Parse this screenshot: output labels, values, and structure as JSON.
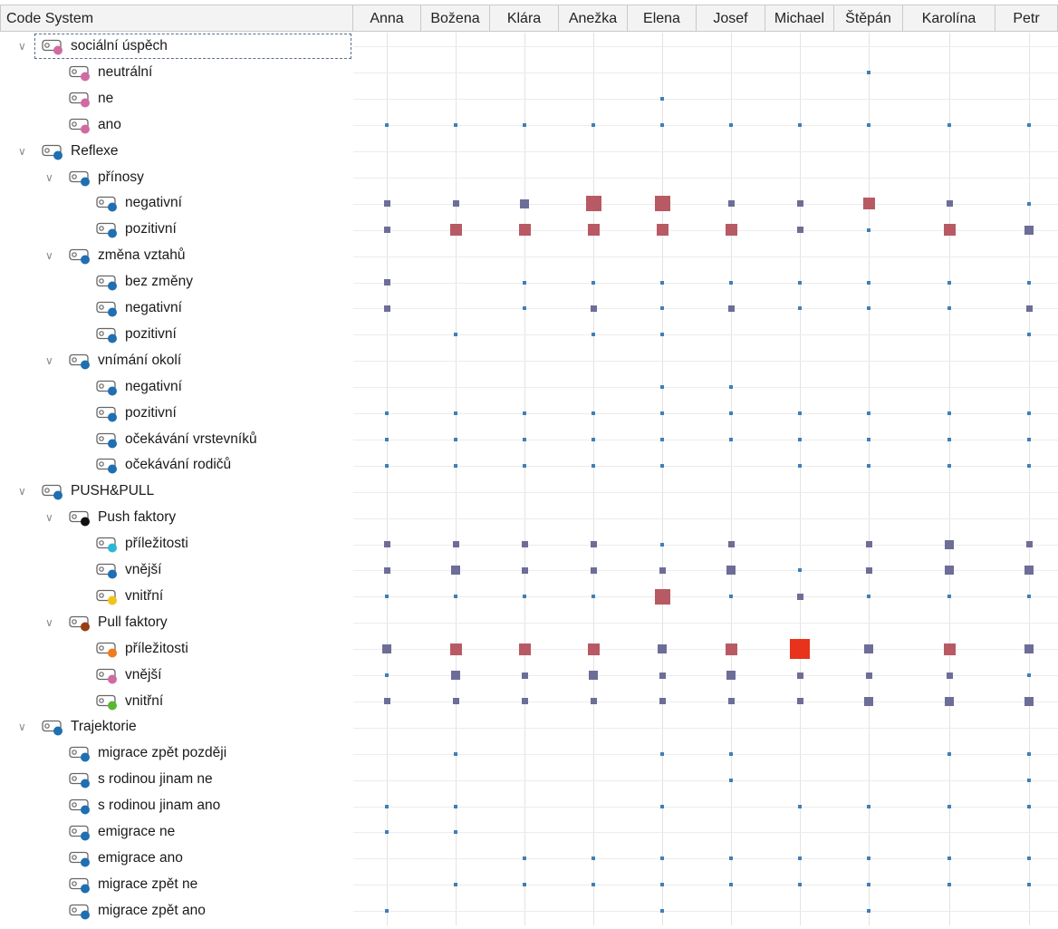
{
  "header": {
    "first_col": "Code System",
    "columns": [
      "Anna",
      "Božena",
      "Klára",
      "Anežka",
      "Elena",
      "Josef",
      "Michael",
      "Štěpán",
      "Karolína",
      "Petr"
    ]
  },
  "colors": {
    "pink": "#d16aa3",
    "blue": "#1f6fb2",
    "black": "#111111",
    "cyan": "#29b8d8",
    "yellow": "#f0c419",
    "brown": "#9a3d12",
    "orange": "#f07a1e",
    "green": "#5ab732",
    "cell_small": "#3f7fb8",
    "cell_mid": "#6d6d98",
    "cell_large": "#b75a64",
    "cell_max": "#e8321c"
  },
  "rows": [
    {
      "label": "sociální úspěch",
      "level": 0,
      "expander": true,
      "dot": "pink",
      "focused": true,
      "cells": [
        0,
        0,
        0,
        0,
        0,
        0,
        0,
        0,
        0,
        0
      ]
    },
    {
      "label": "neutrální",
      "level": 1,
      "expander": false,
      "dot": "pink",
      "cells": [
        0,
        0,
        0,
        0,
        0,
        0,
        0,
        1,
        0,
        0
      ]
    },
    {
      "label": "ne",
      "level": 1,
      "expander": false,
      "dot": "pink",
      "cells": [
        0,
        0,
        0,
        0,
        1,
        0,
        0,
        0,
        0,
        0
      ]
    },
    {
      "label": "ano",
      "level": 1,
      "expander": false,
      "dot": "pink",
      "cells": [
        1,
        1,
        1,
        1,
        1,
        1,
        1,
        1,
        1,
        1
      ]
    },
    {
      "label": "Reflexe",
      "level": 0,
      "expander": true,
      "dot": "blue",
      "cells": [
        0,
        0,
        0,
        0,
        0,
        0,
        0,
        0,
        0,
        0
      ]
    },
    {
      "label": "přínosy",
      "level": 1,
      "expander": true,
      "dot": "blue",
      "cells": [
        0,
        0,
        0,
        0,
        0,
        0,
        0,
        0,
        0,
        0
      ]
    },
    {
      "label": "negativní",
      "level": 2,
      "expander": false,
      "dot": "blue",
      "cells": [
        2,
        2,
        3,
        5,
        5,
        2,
        2,
        4,
        2,
        1
      ]
    },
    {
      "label": "pozitivní",
      "level": 2,
      "expander": false,
      "dot": "blue",
      "cells": [
        2,
        4,
        4,
        4,
        4,
        4,
        2,
        1,
        4,
        3
      ]
    },
    {
      "label": "změna vztahů",
      "level": 1,
      "expander": true,
      "dot": "blue",
      "cells": [
        0,
        0,
        0,
        0,
        0,
        0,
        0,
        0,
        0,
        0
      ]
    },
    {
      "label": "bez změny",
      "level": 2,
      "expander": false,
      "dot": "blue",
      "cells": [
        2,
        0,
        1,
        1,
        1,
        1,
        1,
        1,
        1,
        1
      ]
    },
    {
      "label": "negativní",
      "level": 2,
      "expander": false,
      "dot": "blue",
      "cells": [
        2,
        0,
        1,
        2,
        1,
        2,
        1,
        1,
        1,
        2
      ]
    },
    {
      "label": "pozitivní",
      "level": 2,
      "expander": false,
      "dot": "blue",
      "cells": [
        0,
        1,
        0,
        1,
        1,
        0,
        0,
        0,
        0,
        1
      ]
    },
    {
      "label": "vnímání okolí",
      "level": 1,
      "expander": true,
      "dot": "blue",
      "cells": [
        0,
        0,
        0,
        0,
        0,
        0,
        0,
        0,
        0,
        0
      ]
    },
    {
      "label": "negativní",
      "level": 2,
      "expander": false,
      "dot": "blue",
      "cells": [
        0,
        0,
        0,
        0,
        1,
        1,
        0,
        0,
        0,
        0
      ]
    },
    {
      "label": "pozitivní",
      "level": 2,
      "expander": false,
      "dot": "blue",
      "cells": [
        1,
        1,
        1,
        1,
        1,
        1,
        1,
        1,
        1,
        1
      ]
    },
    {
      "label": "očekávání vrstevníků",
      "level": 2,
      "expander": false,
      "dot": "blue",
      "cells": [
        1,
        1,
        1,
        1,
        1,
        1,
        1,
        1,
        1,
        1
      ]
    },
    {
      "label": "očekávání rodičů",
      "level": 2,
      "expander": false,
      "dot": "blue",
      "cells": [
        1,
        1,
        1,
        1,
        1,
        0,
        1,
        1,
        1,
        1
      ]
    },
    {
      "label": "PUSH&PULL",
      "level": 0,
      "expander": true,
      "dot": "blue",
      "cells": [
        0,
        0,
        0,
        0,
        0,
        0,
        0,
        0,
        0,
        0
      ]
    },
    {
      "label": "Push faktory",
      "level": 1,
      "expander": true,
      "dot": "black",
      "cells": [
        0,
        0,
        0,
        0,
        0,
        0,
        0,
        0,
        0,
        0
      ]
    },
    {
      "label": "příležitosti",
      "level": 2,
      "expander": false,
      "dot": "cyan",
      "cells": [
        2,
        2,
        2,
        2,
        1,
        2,
        0,
        2,
        3,
        2
      ]
    },
    {
      "label": "vnější",
      "level": 2,
      "expander": false,
      "dot": "blue",
      "cells": [
        2,
        3,
        2,
        2,
        2,
        3,
        1,
        2,
        3,
        3
      ]
    },
    {
      "label": "vnitřní",
      "level": 2,
      "expander": false,
      "dot": "yellow",
      "cells": [
        1,
        1,
        1,
        1,
        5,
        1,
        2,
        1,
        1,
        1
      ]
    },
    {
      "label": "Pull faktory",
      "level": 1,
      "expander": true,
      "dot": "brown",
      "cells": [
        0,
        0,
        0,
        0,
        0,
        0,
        0,
        0,
        0,
        0
      ]
    },
    {
      "label": "příležitosti",
      "level": 2,
      "expander": false,
      "dot": "orange",
      "cells": [
        3,
        4,
        4,
        4,
        3,
        4,
        6,
        3,
        4,
        3
      ]
    },
    {
      "label": "vnější",
      "level": 2,
      "expander": false,
      "dot": "pink",
      "cells": [
        1,
        3,
        2,
        3,
        2,
        3,
        2,
        2,
        2,
        1
      ]
    },
    {
      "label": "vnitřní",
      "level": 2,
      "expander": false,
      "dot": "green",
      "cells": [
        2,
        2,
        2,
        2,
        2,
        2,
        2,
        3,
        3,
        3
      ]
    },
    {
      "label": "Trajektorie",
      "level": 0,
      "expander": true,
      "dot": "blue",
      "cells": [
        0,
        0,
        0,
        0,
        0,
        0,
        0,
        0,
        0,
        0
      ]
    },
    {
      "label": "migrace zpět později",
      "level": 1,
      "expander": false,
      "dot": "blue",
      "cells": [
        0,
        1,
        0,
        0,
        1,
        1,
        0,
        0,
        1,
        1
      ]
    },
    {
      "label": "s rodinou jinam ne",
      "level": 1,
      "expander": false,
      "dot": "blue",
      "cells": [
        0,
        0,
        0,
        0,
        0,
        1,
        0,
        0,
        0,
        1
      ]
    },
    {
      "label": "s rodinou jinam ano",
      "level": 1,
      "expander": false,
      "dot": "blue",
      "cells": [
        1,
        1,
        0,
        0,
        1,
        0,
        1,
        1,
        1,
        1
      ]
    },
    {
      "label": "emigrace ne",
      "level": 1,
      "expander": false,
      "dot": "blue",
      "cells": [
        1,
        1,
        0,
        0,
        0,
        0,
        0,
        0,
        0,
        0
      ]
    },
    {
      "label": "emigrace ano",
      "level": 1,
      "expander": false,
      "dot": "blue",
      "cells": [
        0,
        0,
        1,
        1,
        1,
        1,
        1,
        1,
        1,
        1
      ]
    },
    {
      "label": "migrace zpět ne",
      "level": 1,
      "expander": false,
      "dot": "blue",
      "cells": [
        0,
        1,
        1,
        1,
        1,
        1,
        1,
        1,
        1,
        1
      ]
    },
    {
      "label": "migrace zpět ano",
      "level": 1,
      "expander": false,
      "dot": "blue",
      "cells": [
        1,
        0,
        0,
        0,
        1,
        0,
        0,
        1,
        0,
        0
      ]
    }
  ]
}
